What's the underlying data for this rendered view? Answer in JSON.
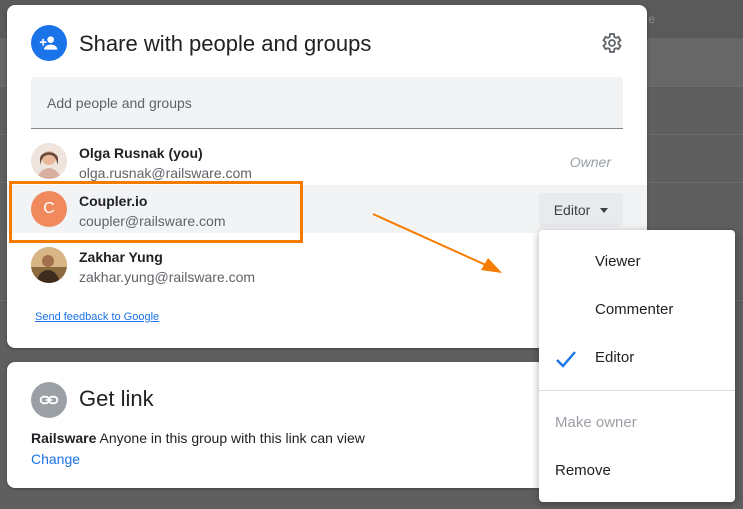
{
  "background": {
    "owner_hint": "e"
  },
  "share": {
    "title": "Share with people and groups",
    "add_placeholder": "Add people and groups",
    "people": [
      {
        "name": "Olga Rusnak (you)",
        "email": "olga.rusnak@railsware.com",
        "role": "Owner"
      },
      {
        "name": "Coupler.io",
        "email": "coupler@railsware.com",
        "role": "Editor",
        "initial": "C"
      },
      {
        "name": "Zakhar Yung",
        "email": "zakhar.yung@railsware.com"
      }
    ],
    "feedback_link": "Send feedback to Google"
  },
  "get_link": {
    "title": "Get link",
    "org": "Railsware",
    "description": " Anyone in this group with this link can view",
    "change_label": "Change"
  },
  "role_menu": {
    "items": [
      "Viewer",
      "Commenter",
      "Editor"
    ],
    "selected": "Editor",
    "make_owner": "Make owner",
    "remove": "Remove"
  },
  "colors": {
    "accent": "#1a73e8",
    "highlight": "#f57c00",
    "coupler_avatar": "#f08a5d"
  }
}
